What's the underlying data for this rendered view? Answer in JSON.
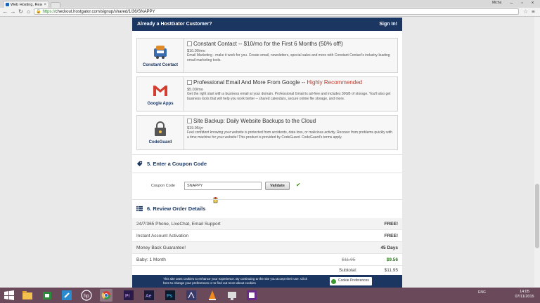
{
  "browser": {
    "tab_title": "Web Hosting, Reselle",
    "window_user": "Micha",
    "url_scheme": "https://",
    "url_rest": "checkout.hostgator.com/signup/shared/1/36/SNAPPY"
  },
  "header": {
    "question": "Already a HostGator Customer?",
    "sign_in": "Sign In!"
  },
  "addons": [
    {
      "logo_label": "Constant Contact",
      "title": "Constant Contact -- $10/mo for the First 6 Months (50% off!)",
      "highlight": "",
      "price": "$10.00/mo",
      "description": "Email Marketing - make it work for you. Create email, newsletters, special sales and more with Constant Contact's industry-leading email marketing tools."
    },
    {
      "logo_label": "Google Apps",
      "title": "Professional Email And More From Google --",
      "highlight": "Highly Recommended",
      "price": "$5.00/mo",
      "description": "Get the right start with a business email at your domain. Professional Gmail is ad-free and includes 30GB of storage. You'll also get business tools that will help you work better -- shared calendars, secure online file storage, and more."
    },
    {
      "logo_label": "CodeGuard",
      "title": "Site Backup: Daily Website Backups to the Cloud",
      "highlight": "",
      "price": "$19.95/yr",
      "description": "Feel confident knowing your website is protected from accidents, data loss, or malicious activity. Recover from problems quickly with a time machine for your website! This product is provided by CodeGuard. CodeGuard's terms apply."
    }
  ],
  "coupon": {
    "section_title": "5. Enter a Coupon Code",
    "label": "Coupon Code",
    "value": "SNAPPY",
    "validate_label": "Validate",
    "check": "✔"
  },
  "review": {
    "section_title": "6. Review Order Details",
    "rows": [
      {
        "label": "24/7/365 Phone, LiveChat, Email Support",
        "value": "FREE!"
      },
      {
        "label": "Instant Account Activation",
        "value": "FREE!"
      },
      {
        "label": "Money Back Guarantee!",
        "value": "45 Days"
      }
    ],
    "plan": {
      "label": "Baby: 1 Month",
      "old_price": "$11.95",
      "new_price": "$9.56"
    },
    "subtotal_label": "Subtotal:",
    "subtotal_value": "$11.95"
  },
  "cookie": {
    "message": "This site uses cookies to enhance your experience. By continuing to the site you accept their use. Click here to change your preferences or to find out more about cookies",
    "button": "Cookie Preferences"
  },
  "taskbar": {
    "tray_lang": "ENG",
    "time": "14:05",
    "date": "07/11/2015"
  },
  "colors": {
    "brand_navy": "#1b3660",
    "highlight_red": "#c0392b",
    "discount_green": "#2a7a1a",
    "taskbar": "#6a4a5a"
  }
}
